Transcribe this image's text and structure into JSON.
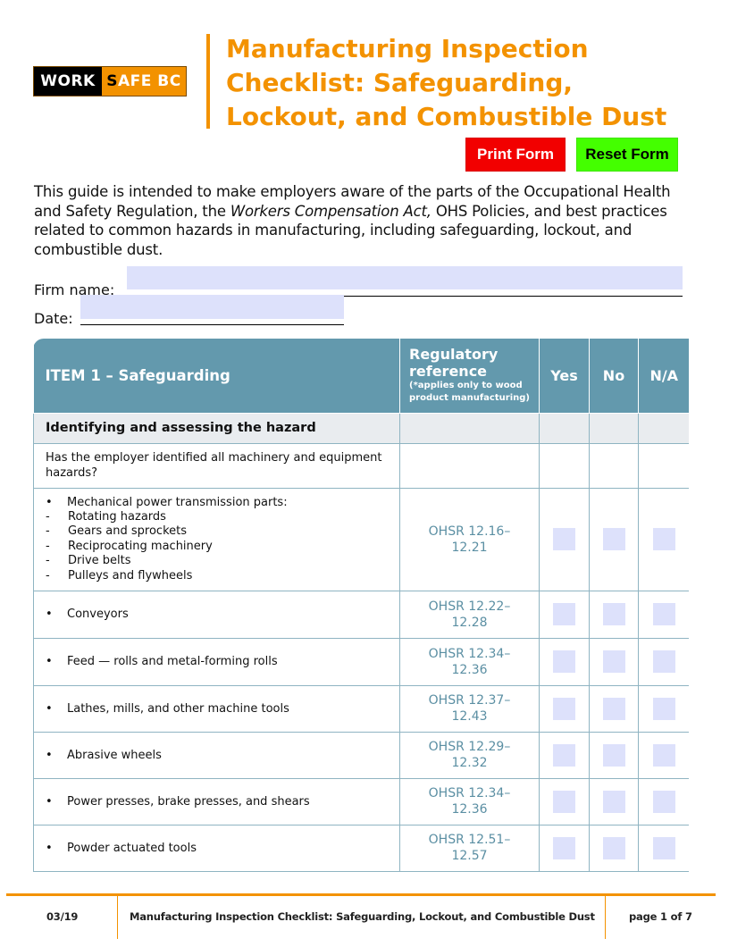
{
  "logo": {
    "part1": "WORK",
    "part2_s": "S",
    "part2_rest": "AFE BC"
  },
  "header": {
    "title_lines": [
      "Manufacturing Inspection",
      "Checklist: Safeguarding,",
      "Lockout, and Combustible Dust"
    ]
  },
  "buttons": {
    "print": "Print Form",
    "reset": "Reset Form"
  },
  "intro": {
    "before": "This guide is intended to make employers aware of the parts of the Occupational Health and Safety Regulation, the ",
    "italic": "Workers Compensation Act,",
    "after": " OHS Policies, and best practices related to common hazards in manufacturing, including safeguarding, lockout, and combustible dust."
  },
  "form": {
    "firm_label": "Firm name:",
    "firm_value": "",
    "date_label": "Date:",
    "date_value": ""
  },
  "table": {
    "headers": {
      "item": "ITEM 1 – Safeguarding",
      "ref_title": "Regulatory reference",
      "ref_note": "(*applies only to wood product manufacturing)",
      "yes": "Yes",
      "no": "No",
      "na": "N/A"
    },
    "section": "Identifying and assessing the hazard",
    "question": "Has the employer identified all machinery and equipment hazards?",
    "bullet_glyph": "•",
    "dash_glyph": "-",
    "rows": [
      {
        "label": "Mechanical power transmission parts:",
        "subitems": [
          "Rotating hazards",
          "Gears and sprockets",
          "Reciprocating machinery",
          "Drive belts",
          "Pulleys and flywheels"
        ],
        "ref_line1": "OHSR 12.16–",
        "ref_line2": "12.21"
      },
      {
        "label": "Conveyors",
        "ref_line1": "OHSR 12.22–",
        "ref_line2": "12.28"
      },
      {
        "label": "Feed — rolls and metal-forming rolls",
        "ref_line1": "OHSR 12.34–",
        "ref_line2": "12.36"
      },
      {
        "label": "Lathes, mills, and other machine tools",
        "ref_line1": "OHSR 12.37–",
        "ref_line2": "12.43"
      },
      {
        "label": "Abrasive wheels",
        "ref_line1": "OHSR 12.29–",
        "ref_line2": "12.32"
      },
      {
        "label": "Power presses, brake presses, and shears",
        "ref_line1": "OHSR 12.34–",
        "ref_line2": "12.36"
      },
      {
        "label": "Powder actuated tools",
        "ref_line1": "OHSR 12.51–",
        "ref_line2": "12.57"
      }
    ]
  },
  "footer": {
    "date": "03/19",
    "title": "Manufacturing Inspection Checklist: Safeguarding, Lockout, and Combustible Dust",
    "page": "page 1 of 7"
  },
  "colors": {
    "brand_orange": "#f39200",
    "table_header": "#6399ad",
    "reference_text": "#5b8fa3",
    "checkbox_fill": "#dde1fb",
    "print_button": "#f20000",
    "reset_button": "#44ff00"
  }
}
